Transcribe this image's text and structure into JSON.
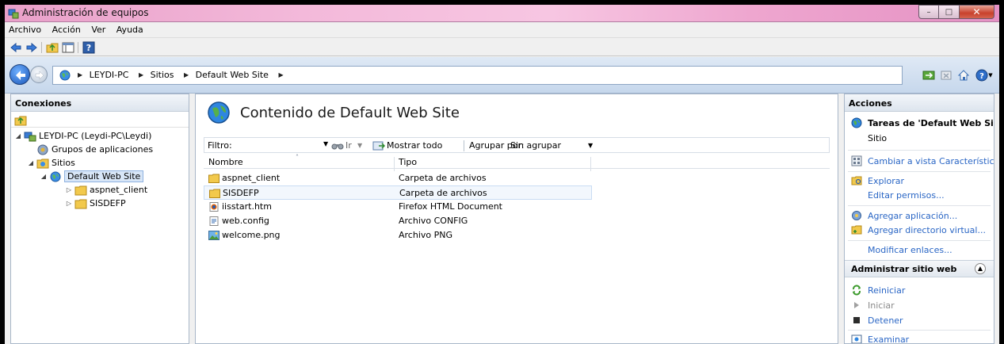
{
  "window": {
    "title": "Administración de equipos"
  },
  "menu": [
    "Archivo",
    "Acción",
    "Ver",
    "Ayuda"
  ],
  "address": {
    "crumbs": [
      "LEYDI-PC",
      "Sitios",
      "Default Web Site"
    ]
  },
  "connections": {
    "header": "Conexiones",
    "tree": [
      {
        "label": "LEYDI-PC (Leydi-PC\\Leydi)",
        "level": 0,
        "icon": "server-icon",
        "expanded": true
      },
      {
        "label": "Grupos de aplicaciones",
        "level": 1,
        "icon": "app-pool-icon"
      },
      {
        "label": "Sitios",
        "level": 1,
        "icon": "sites-folder-icon",
        "expanded": true
      },
      {
        "label": "Default Web Site",
        "level": 2,
        "icon": "globe-icon",
        "expanded": true,
        "selected": true
      },
      {
        "label": "aspnet_client",
        "level": 3,
        "icon": "folder-icon",
        "collapsed": true
      },
      {
        "label": "SISDEFP",
        "level": 3,
        "icon": "folder-icon",
        "collapsed": true
      }
    ]
  },
  "content": {
    "heading": "Contenido de Default Web Site",
    "filter_label": "Filtro:",
    "go_label": "Ir",
    "show_all": "Mostrar todo",
    "group_by_label": "Agrupar por:",
    "group_by_value": "Sin agrupar",
    "columns": [
      "Nombre",
      "Tipo"
    ],
    "rows": [
      {
        "name": "aspnet_client",
        "type": "Carpeta de archivos",
        "icon": "folder-icon"
      },
      {
        "name": "SISDEFP",
        "type": "Carpeta de archivos",
        "icon": "folder-icon",
        "highlighted": true
      },
      {
        "name": "iisstart.htm",
        "type": "Firefox HTML Document",
        "icon": "firefox-file-icon"
      },
      {
        "name": "web.config",
        "type": "Archivo CONFIG",
        "icon": "config-file-icon"
      },
      {
        "name": "welcome.png",
        "type": "Archivo PNG",
        "icon": "image-file-icon"
      }
    ]
  },
  "actions": {
    "header": "Acciones",
    "task_title": "Tareas de 'Default Web Site'",
    "site_label": "Sitio",
    "change_view": "Cambiar a vista Características",
    "explore": "Explorar",
    "edit_perms": "Editar permisos...",
    "add_app": "Agregar aplicación...",
    "add_vdir": "Agregar directorio virtual...",
    "edit_bindings": "Modificar enlaces...",
    "manage_section": "Administrar sitio web",
    "restart": "Reiniciar",
    "start": "Iniciar",
    "stop": "Detener",
    "browse": "Examinar"
  },
  "colors": {
    "titlebar": "#f3b9da",
    "link": "#2a66c5",
    "selection": "#d8e6f7"
  }
}
